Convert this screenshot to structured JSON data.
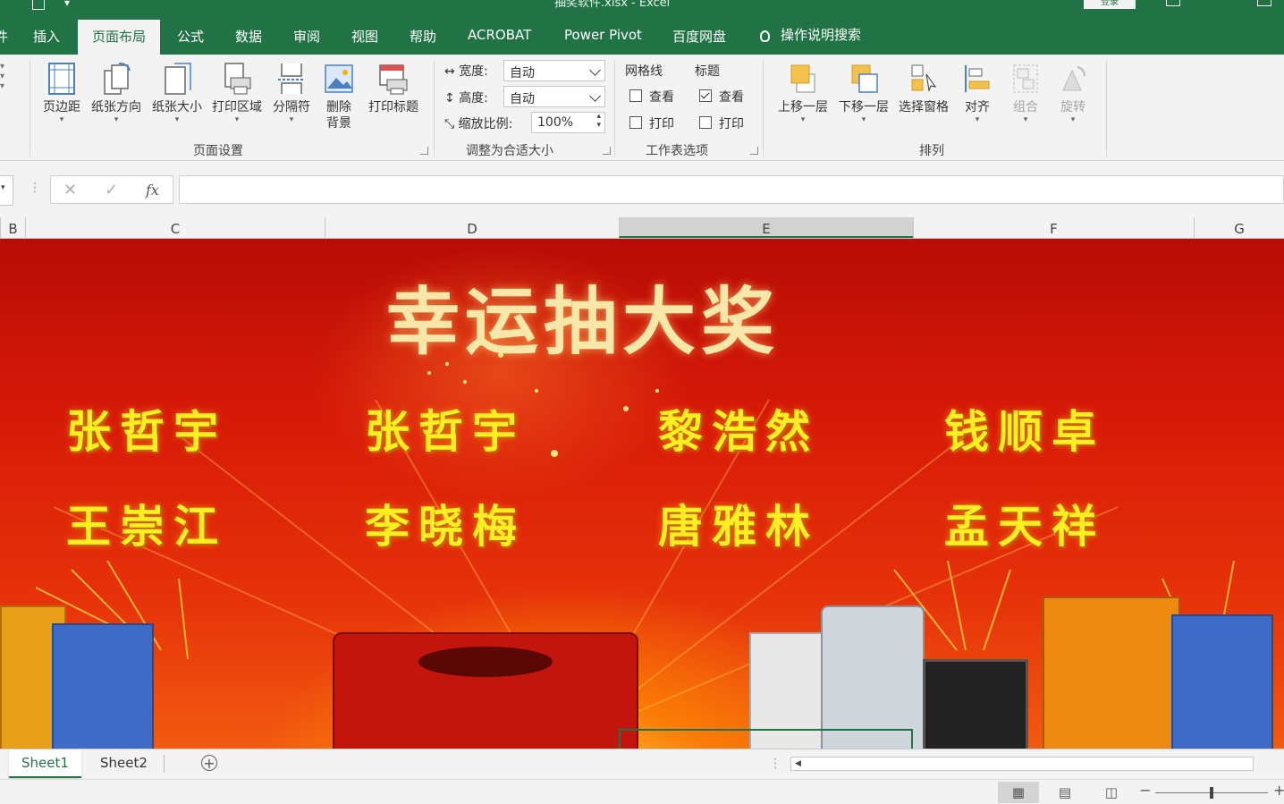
{
  "window": {
    "title": "抽奖软件.xlsx  -  Excel",
    "login_label": "登录"
  },
  "tabs": [
    {
      "label": "插入"
    },
    {
      "label": "页面布局"
    },
    {
      "label": "公式"
    },
    {
      "label": "数据"
    },
    {
      "label": "审阅"
    },
    {
      "label": "视图"
    },
    {
      "label": "帮助"
    },
    {
      "label": "ACROBAT"
    },
    {
      "label": "Power Pivot"
    },
    {
      "label": "百度网盘"
    }
  ],
  "active_tab": "页面布局",
  "tell_me": "操作说明搜索",
  "ribbon": {
    "page_setup": {
      "buttons": [
        {
          "label": "页边距",
          "icon": "margins-icon"
        },
        {
          "label": "纸张方向",
          "icon": "orientation-icon"
        },
        {
          "label": "纸张大小",
          "icon": "paper-size-icon"
        },
        {
          "label": "打印区域",
          "icon": "print-area-icon"
        },
        {
          "label": "分隔符",
          "icon": "breaks-icon"
        },
        {
          "label": "删除",
          "label2": "背景",
          "icon": "background-icon"
        },
        {
          "label": "打印标题",
          "icon": "print-titles-icon"
        }
      ],
      "group_label": "页面设置"
    },
    "scale": {
      "width_label": "宽度:",
      "width_value": "自动",
      "height_label": "高度:",
      "height_value": "自动",
      "scale_label": "缩放比例:",
      "scale_value": "100%",
      "group_label": "调整为合适大小"
    },
    "sheet_options": {
      "gridlines_label": "网格线",
      "headings_label": "标题",
      "view_label": "查看",
      "print_label": "打印",
      "gridlines_view": false,
      "gridlines_print": false,
      "headings_view": true,
      "headings_print": false,
      "group_label": "工作表选项"
    },
    "arrange": {
      "buttons": [
        {
          "label": "上移一层",
          "icon": "bring-forward-icon"
        },
        {
          "label": "下移一层",
          "icon": "send-backward-icon"
        },
        {
          "label": "选择窗格",
          "icon": "selection-pane-icon"
        },
        {
          "label": "对齐",
          "icon": "align-icon"
        },
        {
          "label": "组合",
          "icon": "group-icon"
        },
        {
          "label": "旋转",
          "icon": "rotate-icon"
        }
      ],
      "group_label": "排列"
    }
  },
  "formula_bar": {
    "cancel": "✕",
    "enter": "✓",
    "fx": "fx",
    "value": ""
  },
  "columns": [
    "B",
    "C",
    "D",
    "E",
    "F",
    "G"
  ],
  "selected_column": "E",
  "banner": {
    "title": "幸运抽大奖",
    "names_row1": [
      "张哲宇",
      "张哲宇",
      "黎浩然",
      "钱顺卓"
    ],
    "names_row2": [
      "王崇江",
      "李晓梅",
      "唐雅林",
      "孟天祥"
    ],
    "colors": {
      "title": "#f7e7a8",
      "names": "#ffee22",
      "background": "#d71a08"
    }
  },
  "sheets": [
    {
      "label": "Sheet1"
    },
    {
      "label": "Sheet2"
    }
  ],
  "active_sheet": "Sheet1",
  "colors": {
    "accent": "#217346",
    "ribbon_bg": "#f3f3f3"
  }
}
